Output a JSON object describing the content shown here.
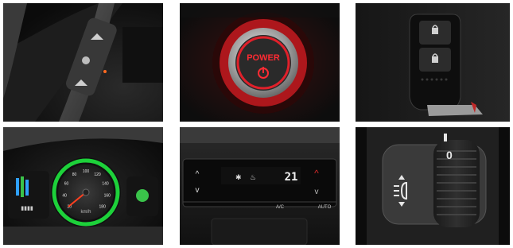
{
  "photos": [
    {
      "subject": "steering-wheel-control-stalk"
    },
    {
      "subject": "engine-start-button",
      "label": "POWER"
    },
    {
      "subject": "smart-key-fob"
    },
    {
      "subject": "instrument-cluster",
      "label": "km/h",
      "ticks": [
        "20",
        "40",
        "60",
        "80",
        "100",
        "120",
        "140",
        "160",
        "180"
      ]
    },
    {
      "subject": "climate-control-panel",
      "temp_display": "21",
      "button_labels": [
        "A/C",
        "AUTO"
      ]
    },
    {
      "subject": "headlight-leveling-dial"
    }
  ],
  "colors": {
    "power_red": "#e0202a",
    "speedo_green": "#1dd13a",
    "hybrid_green": "#3ac34a"
  }
}
